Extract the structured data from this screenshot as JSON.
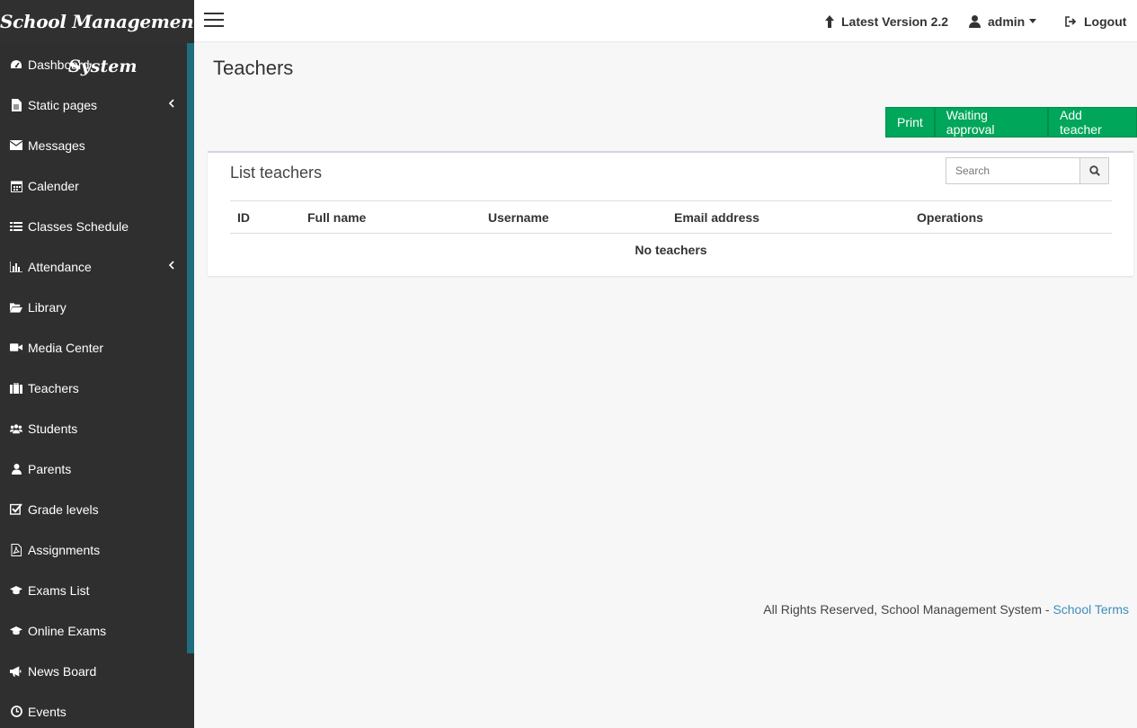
{
  "brand": {
    "line1": "School Management",
    "line2": "System"
  },
  "sidebar": {
    "items": [
      {
        "label": "Dashboard",
        "icon": "dashboard-icon"
      },
      {
        "label": "Static pages",
        "icon": "file-icon",
        "has_children": true
      },
      {
        "label": "Messages",
        "icon": "envelope-icon"
      },
      {
        "label": "Calender",
        "icon": "calendar-icon"
      },
      {
        "label": "Classes Schedule",
        "icon": "list-icon"
      },
      {
        "label": "Attendance",
        "icon": "bar-chart-icon",
        "has_children": true
      },
      {
        "label": "Library",
        "icon": "folder-open-icon"
      },
      {
        "label": "Media Center",
        "icon": "video-camera-icon"
      },
      {
        "label": "Teachers",
        "icon": "briefcase-icon"
      },
      {
        "label": "Students",
        "icon": "users-icon"
      },
      {
        "label": "Parents",
        "icon": "user-icon"
      },
      {
        "label": "Grade levels",
        "icon": "check-square-icon"
      },
      {
        "label": "Assignments",
        "icon": "file-pdf-icon"
      },
      {
        "label": "Exams List",
        "icon": "graduation-cap-icon"
      },
      {
        "label": "Online Exams",
        "icon": "graduation-cap-icon"
      },
      {
        "label": "News Board",
        "icon": "bullhorn-icon"
      },
      {
        "label": "Events",
        "icon": "clock-icon"
      }
    ]
  },
  "topbar": {
    "version_label": "Latest Version 2.2",
    "user_label": "admin",
    "logout_label": "Logout"
  },
  "page": {
    "title": "Teachers"
  },
  "actions": {
    "print": "Print",
    "waiting": "Waiting approval",
    "add": "Add teacher"
  },
  "box": {
    "title": "List teachers",
    "search_placeholder": "Search",
    "columns": [
      "ID",
      "Full name",
      "Username",
      "Email address",
      "Operations"
    ],
    "empty_text": "No teachers"
  },
  "footer": {
    "text": "All Rights Reserved, School Management System - ",
    "link": "School Terms"
  },
  "colors": {
    "sidebar_bg": "#2f2f2f",
    "accent": "#1f6d7e",
    "button_green": "#00a65a",
    "link": "#3c8dbc"
  }
}
